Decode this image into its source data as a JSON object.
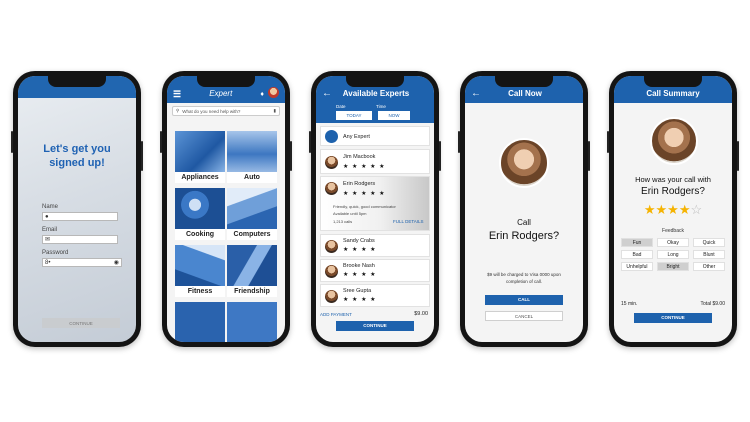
{
  "signup": {
    "heading_line1": "Let's get you",
    "heading_line2": "signed up!",
    "name_label": "Name",
    "email_label": "Email",
    "password_label": "Password",
    "password_value": "8•",
    "continue_label": "CONTINUE"
  },
  "home": {
    "brand": "Expert",
    "search_placeholder": "What do you need help with?",
    "categories": [
      "Appliances",
      "Auto",
      "Cooking",
      "Computers",
      "Fitness",
      "Friendship"
    ]
  },
  "experts": {
    "title": "Available Experts",
    "date_label": "Date",
    "time_label": "Time",
    "date_value": "TODAY",
    "time_value": "NOW",
    "any_expert": "Any Expert",
    "list": [
      {
        "name": "Jim Macbook",
        "stars": "★ ★ ★ ★ ★"
      },
      {
        "name": "Erin Rodgers",
        "stars": "★ ★ ★ ★ ★"
      },
      {
        "name": "Sandy Crabs",
        "stars": "★ ★ ★ ★"
      },
      {
        "name": "Brooke Nash",
        "stars": "★ ★ ★ ★"
      },
      {
        "name": "Sree Gupta",
        "stars": "★ ★ ★ ★"
      }
    ],
    "selected_desc1": "Friendly, quick, good communicator",
    "selected_desc2": "Available until 5pm",
    "selected_calls": "1,213 calls",
    "full_details": "FULL DETAILS",
    "add_payment": "ADD PAYMENT",
    "price": "$9.00",
    "continue_label": "CONTINUE"
  },
  "call_now": {
    "title": "Call Now",
    "call_word": "Call",
    "expert_name": "Erin Rodgers?",
    "charge_line1": "$9 will be charged to Visa 0000 upon",
    "charge_line2": "completion of call.",
    "call_button": "CALL",
    "cancel_button": "CANCEL"
  },
  "summary": {
    "title": "Call Summary",
    "question_line1": "How was your call with",
    "question_line2": "Erin Rodgers?",
    "stars": "★★★★",
    "empty_star": "☆",
    "feedback_label": "Feedback",
    "feedback_options": [
      "Fun",
      "Okay",
      "Quick",
      "Bad",
      "Long",
      "Blunt",
      "Unhelpful",
      "Bright",
      "Other"
    ],
    "duration": "15 min.",
    "total": "Total $9.00",
    "continue_label": "CONTINUE"
  },
  "colors": {
    "brand_blue": "#1e62ad",
    "star_gold": "#f5b301"
  }
}
